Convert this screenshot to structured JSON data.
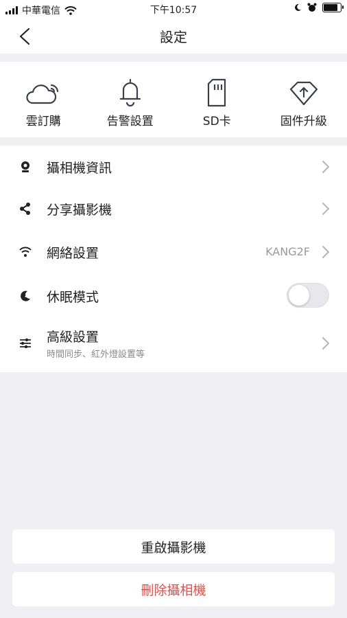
{
  "status_bar": {
    "carrier": "中華電信",
    "time": "下午10:57"
  },
  "nav": {
    "title": "設定"
  },
  "quick_actions": [
    {
      "label": "雲訂購",
      "icon": "cloud-icon"
    },
    {
      "label": "告警設置",
      "icon": "bell-icon"
    },
    {
      "label": "SD卡",
      "icon": "sd-card-icon"
    },
    {
      "label": "固件升級",
      "icon": "firmware-upgrade-icon"
    }
  ],
  "settings": {
    "camera_info": {
      "label": "攝相機資訊",
      "icon": "camera-icon"
    },
    "share_camera": {
      "label": "分享攝影機",
      "icon": "share-icon"
    },
    "network": {
      "label": "網絡設置",
      "value": "KANG2F",
      "icon": "wifi-icon"
    },
    "sleep_mode": {
      "label": "休眠模式",
      "icon": "sleep-moon-icon",
      "enabled": false
    },
    "advanced": {
      "label": "高級設置",
      "subtitle": "時間同步、紅外燈設置等",
      "icon": "sliders-icon"
    }
  },
  "buttons": {
    "restart": "重啟攝影機",
    "delete": "刪除攝相機"
  },
  "colors": {
    "danger": "#d9534f",
    "background": "#f0f0f4"
  }
}
